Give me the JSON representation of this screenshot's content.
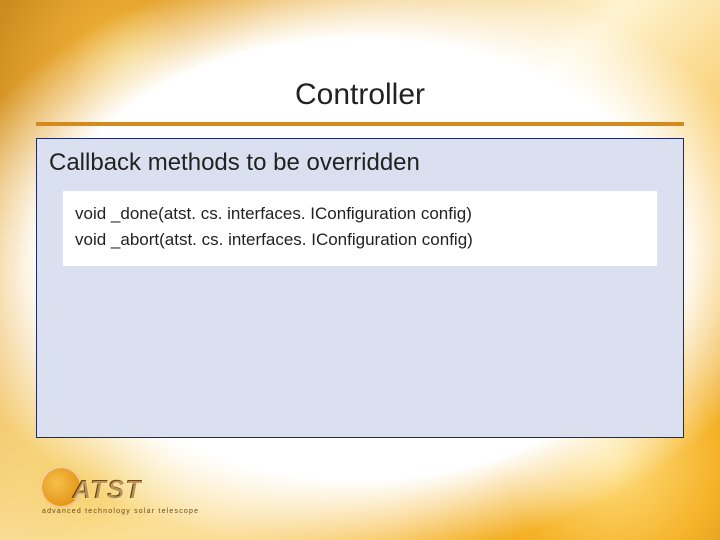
{
  "title": "Controller",
  "subtitle": "Callback methods to be overridden",
  "code_lines": [
    "void _done(atst. cs. interfaces. IConfiguration config)",
    "void _abort(atst. cs. interfaces. IConfiguration config)"
  ],
  "logo": {
    "text": "ATST",
    "sub": "advanced technology solar telescope"
  }
}
